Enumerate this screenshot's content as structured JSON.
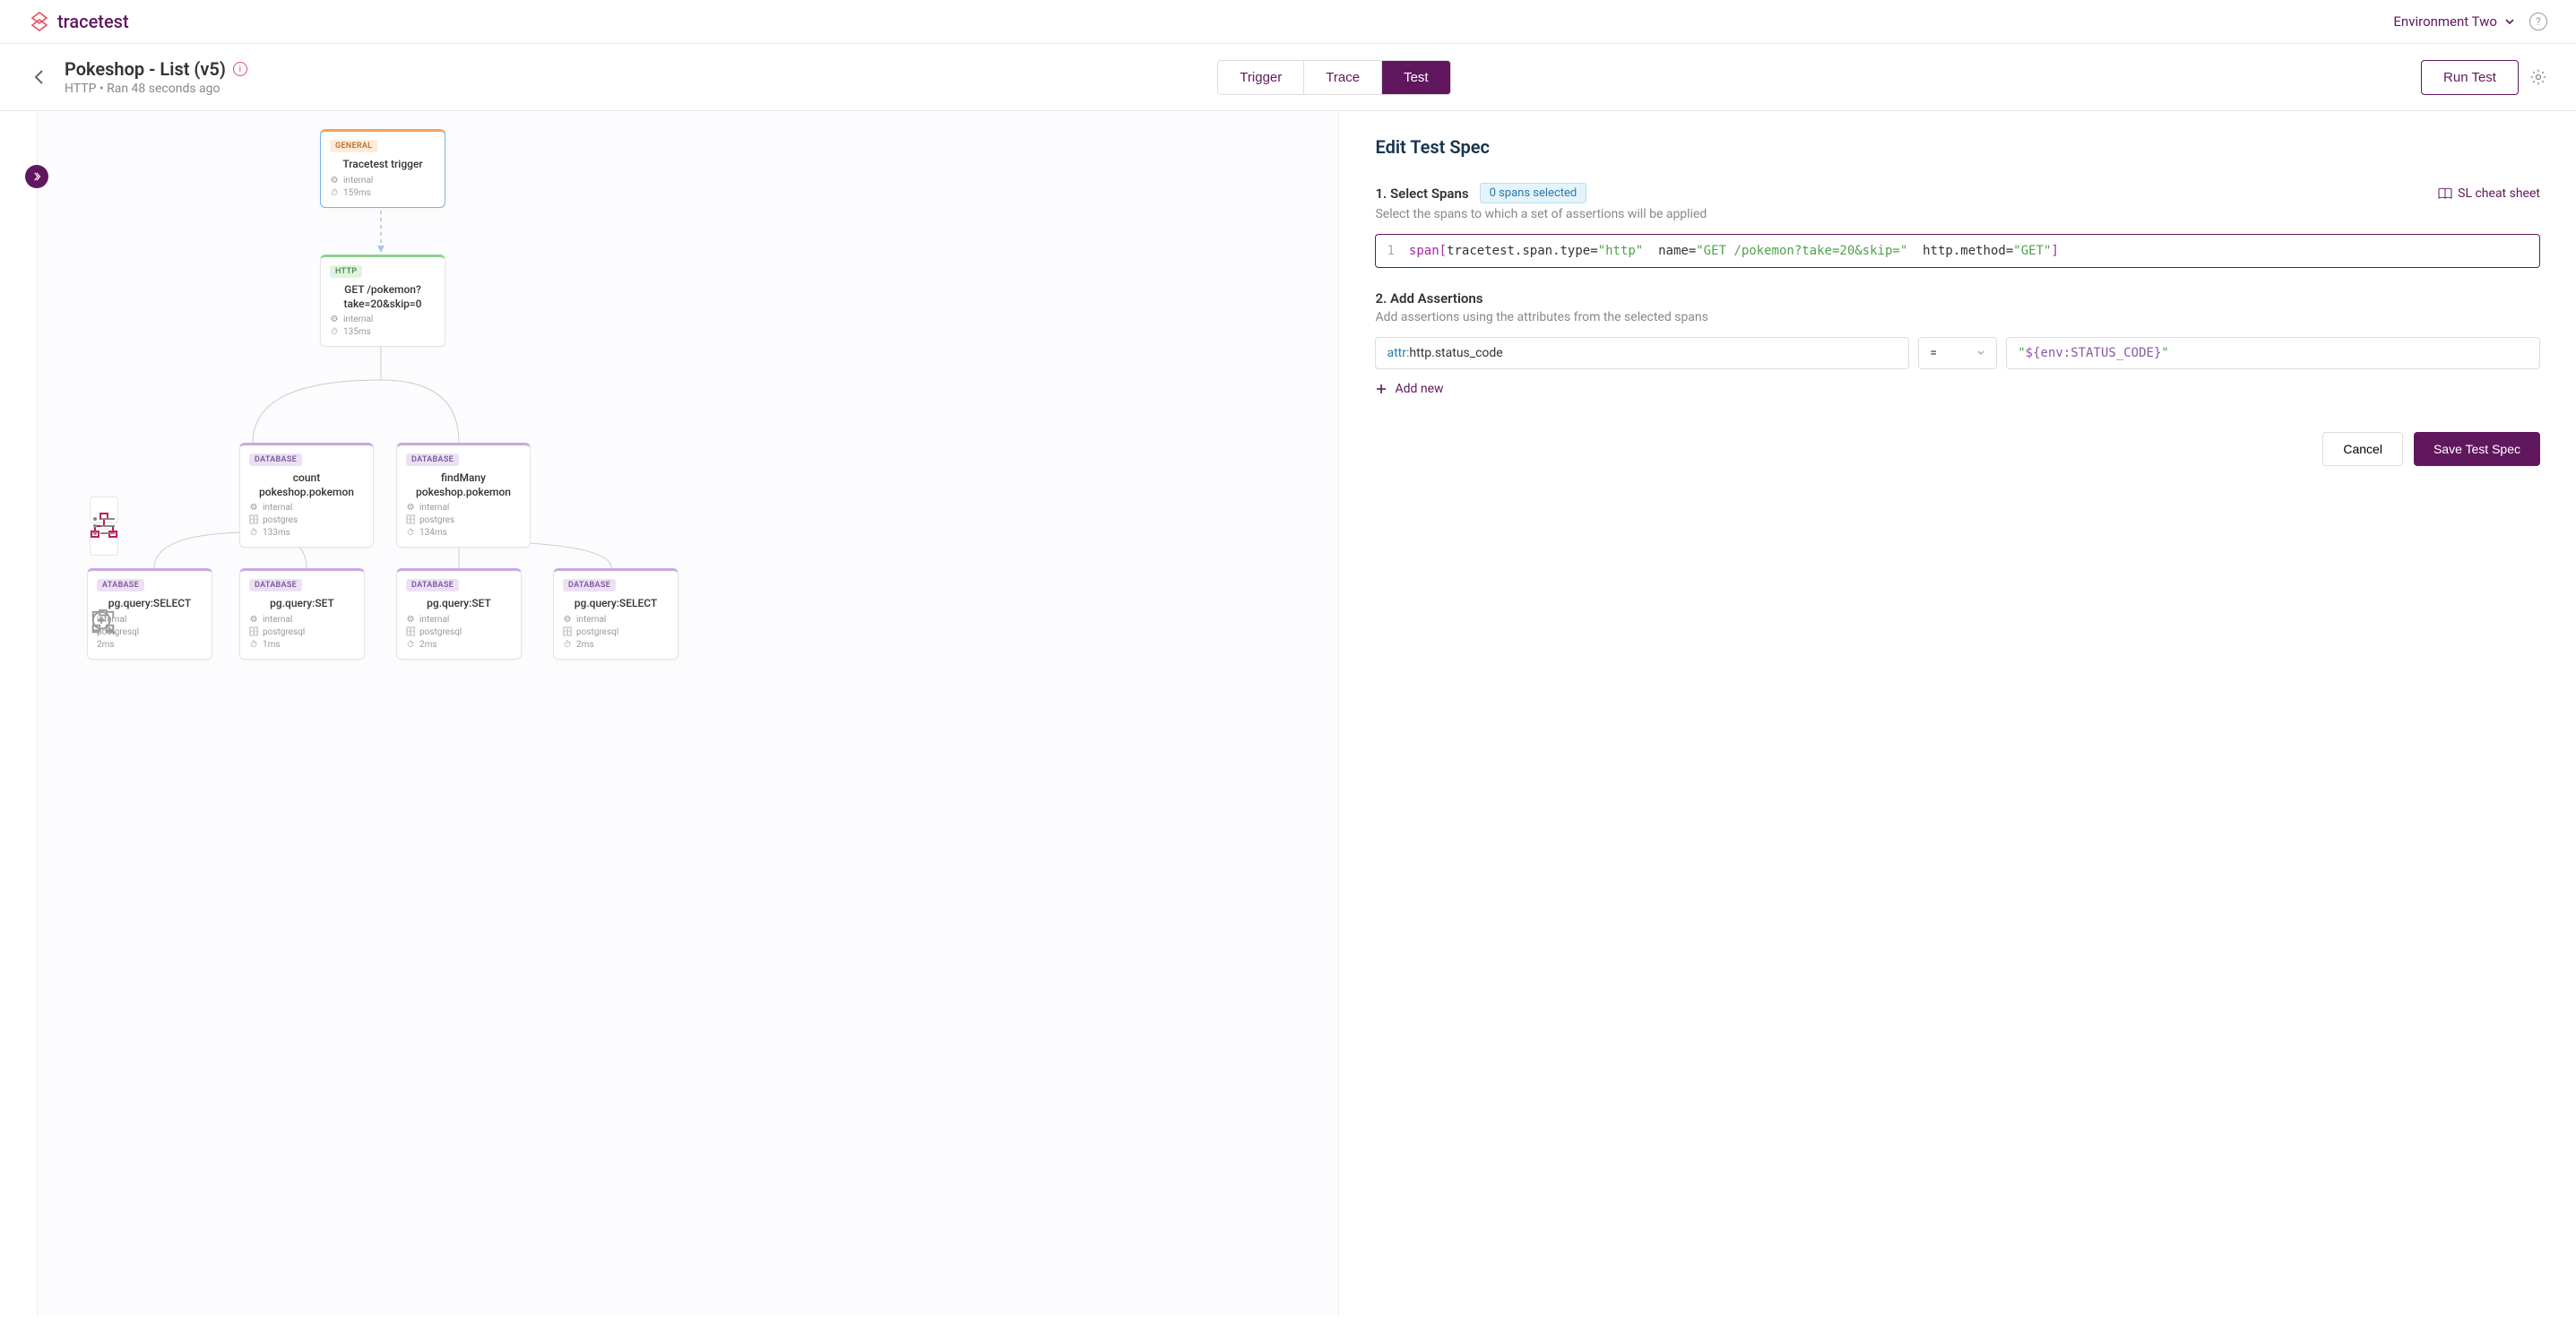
{
  "brand": "tracetest",
  "topbar": {
    "environment": "Environment Two"
  },
  "subheader": {
    "title": "Pokeshop - List (v5)",
    "subtitle": "HTTP • Ran 48 seconds ago",
    "tabs": {
      "trigger": "Trigger",
      "trace": "Trace",
      "test": "Test"
    },
    "run_label": "Run Test"
  },
  "canvas": {
    "nodes": {
      "n1": {
        "badge": "GENERAL",
        "name": "Tracetest trigger",
        "internal": "internal",
        "time": "159ms"
      },
      "n2": {
        "badge": "HTTP",
        "name": "GET /pokemon?take=20&skip=0",
        "internal": "internal",
        "time": "135ms"
      },
      "n3": {
        "badge": "DATABASE",
        "name": "count pokeshop.pokemon",
        "internal": "internal",
        "db": "postgres",
        "time": "133ms"
      },
      "n4": {
        "badge": "DATABASE",
        "name": "findMany pokeshop.pokemon",
        "internal": "internal",
        "db": "postgres",
        "time": "134ms"
      },
      "n5": {
        "badge": "ATABASE",
        "name": "pg.query:SELECT",
        "internal": "internal",
        "db": "postgresql",
        "time": "2ms"
      },
      "n6": {
        "badge": "DATABASE",
        "name": "pg.query:SET",
        "internal": "internal",
        "db": "postgresql",
        "time": "1ms"
      },
      "n7": {
        "badge": "DATABASE",
        "name": "pg.query:SET",
        "internal": "internal",
        "db": "postgresql",
        "time": "2ms"
      },
      "n8": {
        "badge": "DATABASE",
        "name": "pg.query:SELECT",
        "internal": "internal",
        "db": "postgresql",
        "time": "2ms"
      }
    }
  },
  "panel": {
    "title": "Edit Test Spec",
    "s1": {
      "heading": "1. Select Spans",
      "badge": "0 spans selected",
      "link": "SL cheat sheet",
      "desc": "Select the spans to which a set of assertions will be applied"
    },
    "code": {
      "gutter": "1",
      "kw": "span",
      "br1": "[",
      "a1": "tracetest.span.type",
      "eq": "=",
      "v1": "\"http\"",
      "a2": "name",
      "v2": "\"GET /pokemon?take=20&skip=\"",
      "a3": "http.method",
      "v3": "\"GET\"",
      "br2": "]"
    },
    "s2": {
      "heading": "2. Add Assertions",
      "desc": "Add assertions using the attributes from the selected spans"
    },
    "assertion": {
      "prefix": "attr:",
      "name": "http.status_code",
      "op": "=",
      "val_q1": "\"",
      "val_env": "${env:STATUS_CODE}",
      "val_q2": "\""
    },
    "add_new": "Add new",
    "cancel": "Cancel",
    "save": "Save Test Spec"
  }
}
